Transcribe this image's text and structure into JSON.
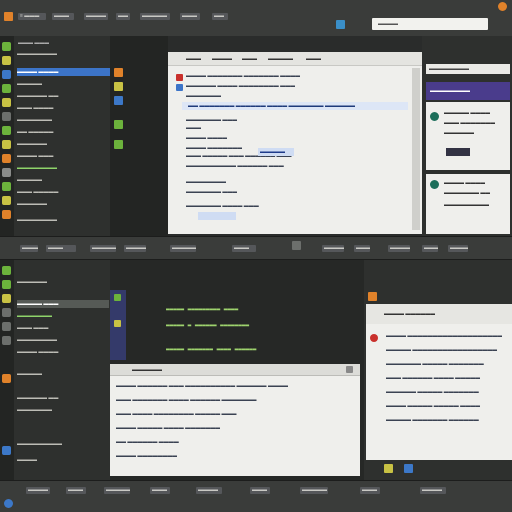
{
  "colors": {
    "accent": "#3c74c8",
    "code_green": "#9fd46e",
    "orange": "#e0822a",
    "red": "#c9302c",
    "purple": "#4a3c8c"
  },
  "top_bar": {
    "tabs": [
      "≡ ▬▬▬",
      "▬▬▬",
      "▬▬▬▬",
      "▬▬",
      "▬▬▬▬▬",
      "▬▬▬",
      "▬▬"
    ],
    "search_placeholder": "▬▬▬▬"
  },
  "left_sidebar_top": {
    "header": "▬▬▬ ▬▬▬",
    "items": [
      "▬▬▬▬▬▬▬▬",
      "▬▬▬▬ ▬▬▬▬",
      "▬▬▬▬▬",
      "▬▬▬▬▬▬ ▬▬",
      "▬▬▬ ▬▬▬▬",
      "▬▬▬▬▬▬▬",
      "▬▬ ▬▬▬▬▬",
      "▬▬▬▬▬▬",
      "▬▬▬▬ ▬▬▬",
      "▬▬▬▬▬▬▬▬",
      "▬▬▬▬▬",
      "▬▬▬ ▬▬▬▬▬",
      "▬▬▬▬▬▬",
      "▬▬▬▬▬▬▬▬"
    ]
  },
  "doc_top": {
    "menu": [
      "▬▬▬",
      "▬▬▬▬",
      "▬▬▬",
      "▬▬▬▬▬",
      "▬▬▬"
    ],
    "lines": [
      "▬▬▬▬ ▬▬▬▬▬▬▬ ▬▬▬▬▬▬▬ ▬▬▬▬",
      "▬▬▬▬▬▬ ▬▬▬▬ ▬▬▬▬▬▬▬▬ ▬▬▬",
      "▬▬▬▬▬▬▬",
      "▬▬ ▬▬▬▬▬▬▬ ▬▬▬▬▬▬ ▬▬▬▬ ▬▬▬▬▬▬▬ ▬▬▬▬▬▬",
      "▬▬▬▬▬▬▬ ▬▬▬",
      "▬▬▬",
      "▬▬▬▬ ▬▬▬▬",
      "▬▬▬▬ ▬▬▬▬▬▬▬",
      "▬▬▬ ▬▬▬▬▬ ▬▬▬ ▬▬▬▬▬▬ ▬▬▬",
      "▬▬▬▬▬▬▬▬▬▬ ▬▬▬▬▬▬ ▬▬▬",
      "▬▬▬▬▬▬▬▬",
      "▬▬▬▬▬▬▬ ▬▬▬",
      "▬▬▬▬▬▬▬ ▬▬▬▬ ▬▬▬"
    ],
    "highlight": "▬▬▬▬▬"
  },
  "right_panel_top": {
    "search": "▬▬▬▬▬▬▬▬",
    "header": "▬▬▬▬▬▬▬▬",
    "items": [
      "▬▬▬▬▬ ▬▬▬▬",
      "▬▬▬ ▬▬▬▬▬▬▬",
      "▬▬▬▬▬▬",
      "▬▬▬▬ ▬▬▬▬",
      "▬▬▬▬▬▬▬ ▬▬",
      "▬▬▬▬▬▬▬▬▬"
    ]
  },
  "mid_bar": {
    "tabs": [
      "▬▬▬▬",
      "▬▬▬",
      "▬▬▬▬▬",
      "▬▬▬▬",
      "▬▬▬▬▬▬",
      "▬▬▬",
      "▬▬▬▬",
      "▬▬▬",
      "▬▬▬▬",
      "▬▬▬",
      "▬▬▬▬"
    ]
  },
  "left_sidebar_bottom": {
    "items": [
      "▬▬▬▬▬▬",
      "▬▬▬▬▬ ▬▬▬",
      "▬▬▬▬▬▬▬",
      "▬▬▬ ▬▬▬",
      "▬▬▬▬▬▬▬▬",
      "▬▬▬▬ ▬▬▬▬",
      "▬▬▬▬▬",
      "▬▬▬▬▬▬ ▬▬",
      "▬▬▬▬▬▬▬",
      "▬▬▬▬▬▬▬▬▬",
      "▬▬▬▬"
    ]
  },
  "editor_bottom": {
    "code": [
      "▬▬▬▬▬ ▬▬▬▬▬▬▬▬▬ ▬▬▬▬",
      "▬▬▬▬▬ ▬ ▬▬▬▬▬▬ ▬▬▬▬▬▬▬▬",
      "▬▬▬▬▬ ▬▬▬▬▬▬▬ ▬▬▬▬ ▬▬▬▬▬▬"
    ],
    "table_header": "▬▬▬▬▬▬",
    "rows": [
      "▬▬▬▬ ▬▬▬▬▬▬ ▬▬▬ ▬▬▬▬▬▬▬▬▬▬ ▬▬▬▬▬▬ ▬▬▬▬",
      "▬▬▬ ▬▬▬▬▬▬▬ ▬▬▬▬ ▬▬▬▬▬▬ ▬▬▬▬▬▬▬",
      "▬▬▬ ▬▬▬▬ ▬▬▬▬▬▬▬▬ ▬▬▬▬▬ ▬▬▬",
      "▬▬▬▬ ▬▬▬▬▬ ▬▬▬▬ ▬▬▬▬▬▬▬",
      "▬▬ ▬▬▬▬▬▬ ▬▬▬▬",
      "▬▬▬▬ ▬▬▬▬▬▬▬▬"
    ]
  },
  "right_panel_bottom": {
    "header": "▬▬▬▬ ▬▬▬▬▬▬",
    "lines": [
      "▬▬▬▬ ▬▬▬▬▬▬▬▬▬▬▬▬▬▬▬▬▬▬▬",
      "▬▬▬▬▬ ▬▬▬▬▬▬▬▬▬▬▬▬▬▬▬▬▬",
      "▬▬▬▬▬▬▬ ▬▬▬▬▬ ▬▬▬▬▬▬▬",
      "▬▬▬ ▬▬▬▬▬▬ ▬▬▬▬ ▬▬▬▬▬",
      "▬▬▬▬▬▬ ▬▬▬▬▬ ▬▬▬▬▬▬▬",
      "▬▬▬▬ ▬▬▬▬▬ ▬▬▬▬▬ ▬▬▬▬",
      "▬▬▬▬▬ ▬▬▬▬▬▬▬ ▬▬▬▬▬▬"
    ]
  },
  "bottom_bar": {
    "tabs": [
      "▬▬▬▬",
      "▬▬▬",
      "▬▬▬▬▬",
      "▬▬▬",
      "▬▬▬▬",
      "▬▬▬",
      "▬▬▬▬▬",
      "▬▬▬",
      "▬▬▬▬"
    ]
  }
}
